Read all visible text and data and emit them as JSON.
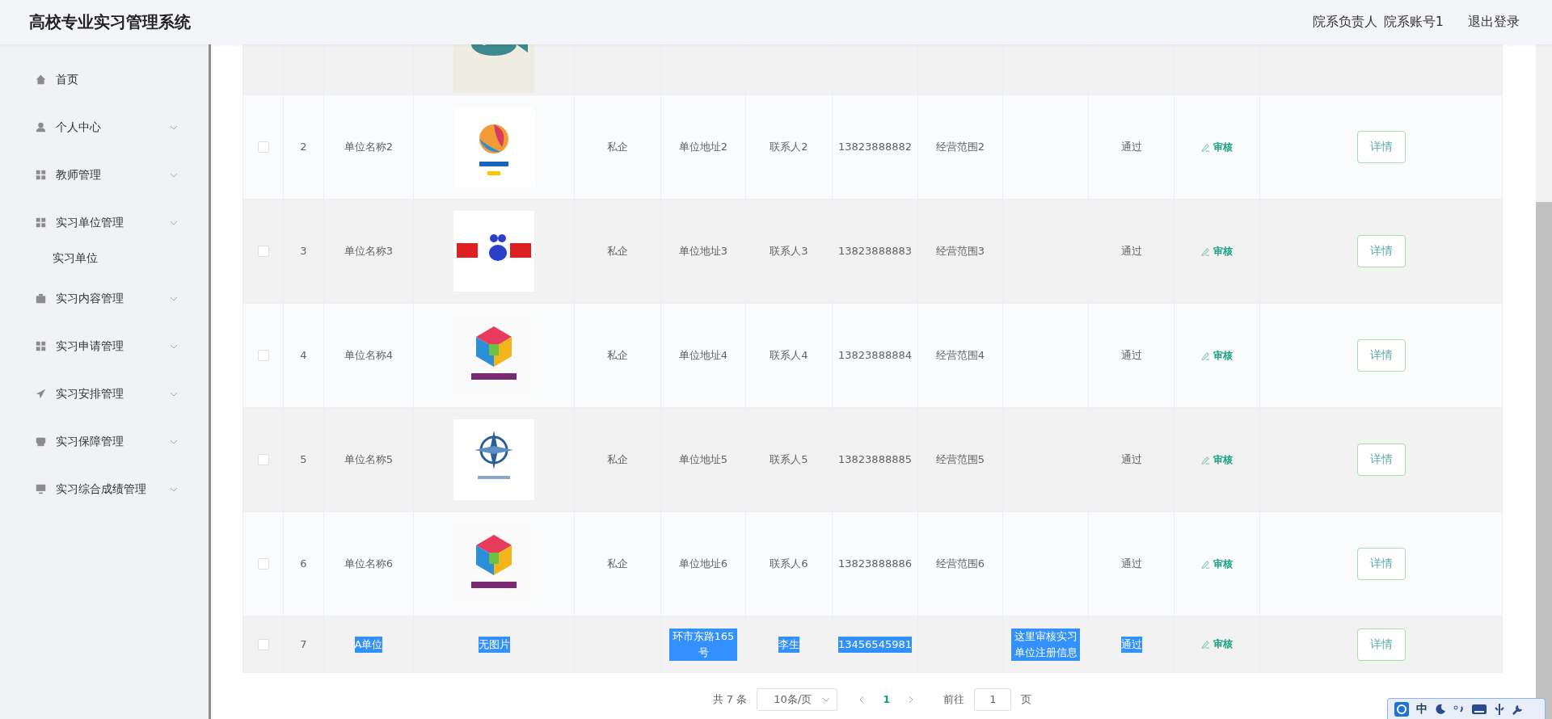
{
  "header": {
    "title": "高校专业实习管理系统",
    "role": "院系负责人",
    "account": "院系账号1",
    "logout": "退出登录"
  },
  "sidebar": {
    "items": [
      {
        "label": "首页",
        "has_children": false
      },
      {
        "label": "个人中心",
        "has_children": true
      },
      {
        "label": "教师管理",
        "has_children": true
      },
      {
        "label": "实习单位管理",
        "has_children": true,
        "expanded": true,
        "children": [
          {
            "label": "实习单位"
          }
        ]
      },
      {
        "label": "实习内容管理",
        "has_children": true
      },
      {
        "label": "实习申请管理",
        "has_children": true
      },
      {
        "label": "实习安排管理",
        "has_children": true
      },
      {
        "label": "实习保障管理",
        "has_children": true
      },
      {
        "label": "实习综合成绩管理",
        "has_children": true
      }
    ]
  },
  "table": {
    "rows": [
      {
        "checked": false,
        "index": "2",
        "name": "单位名称2",
        "type": "私企",
        "address": "单位地址2",
        "contact": "联系人2",
        "phone": "13823888882",
        "scope": "经营范围2",
        "status": "通过",
        "review": "审核",
        "details": "详情",
        "text_selected": false
      },
      {
        "checked": false,
        "index": "3",
        "name": "单位名称3",
        "type": "私企",
        "address": "单位地址3",
        "contact": "联系人3",
        "phone": "13823888883",
        "scope": "经营范围3",
        "status": "通过",
        "review": "审核",
        "details": "详情",
        "text_selected": false
      },
      {
        "checked": false,
        "index": "4",
        "name": "单位名称4",
        "type": "私企",
        "address": "单位地址4",
        "contact": "联系人4",
        "phone": "13823888884",
        "scope": "经营范围4",
        "status": "通过",
        "review": "审核",
        "details": "详情",
        "text_selected": false
      },
      {
        "checked": false,
        "index": "5",
        "name": "单位名称5",
        "type": "私企",
        "address": "单位地址5",
        "contact": "联系人5",
        "phone": "13823888885",
        "scope": "经营范围5",
        "status": "通过",
        "review": "审核",
        "details": "详情",
        "text_selected": false
      },
      {
        "checked": false,
        "index": "6",
        "name": "单位名称6",
        "type": "私企",
        "address": "单位地址6",
        "contact": "联系人6",
        "phone": "13823888886",
        "scope": "经营范围6",
        "status": "通过",
        "review": "审核",
        "details": "详情",
        "text_selected": false
      },
      {
        "checked": false,
        "index": "7",
        "name": "A单位",
        "logo_text": "无图片",
        "address": "环市东路165号",
        "contact": "李生",
        "phone": "13456545981",
        "remark": "这里审核实习单位注册信息",
        "status": "通过",
        "review": "审核",
        "details": "详情",
        "text_selected": true
      }
    ]
  },
  "pagination": {
    "total": "共 7 条",
    "page_size": "10条/页",
    "pages": [
      {
        "label": "1",
        "selected": true
      }
    ],
    "goto_label": "前往",
    "goto_value": "1",
    "goto_suffix": "页"
  },
  "ime": {
    "mode": "中"
  }
}
